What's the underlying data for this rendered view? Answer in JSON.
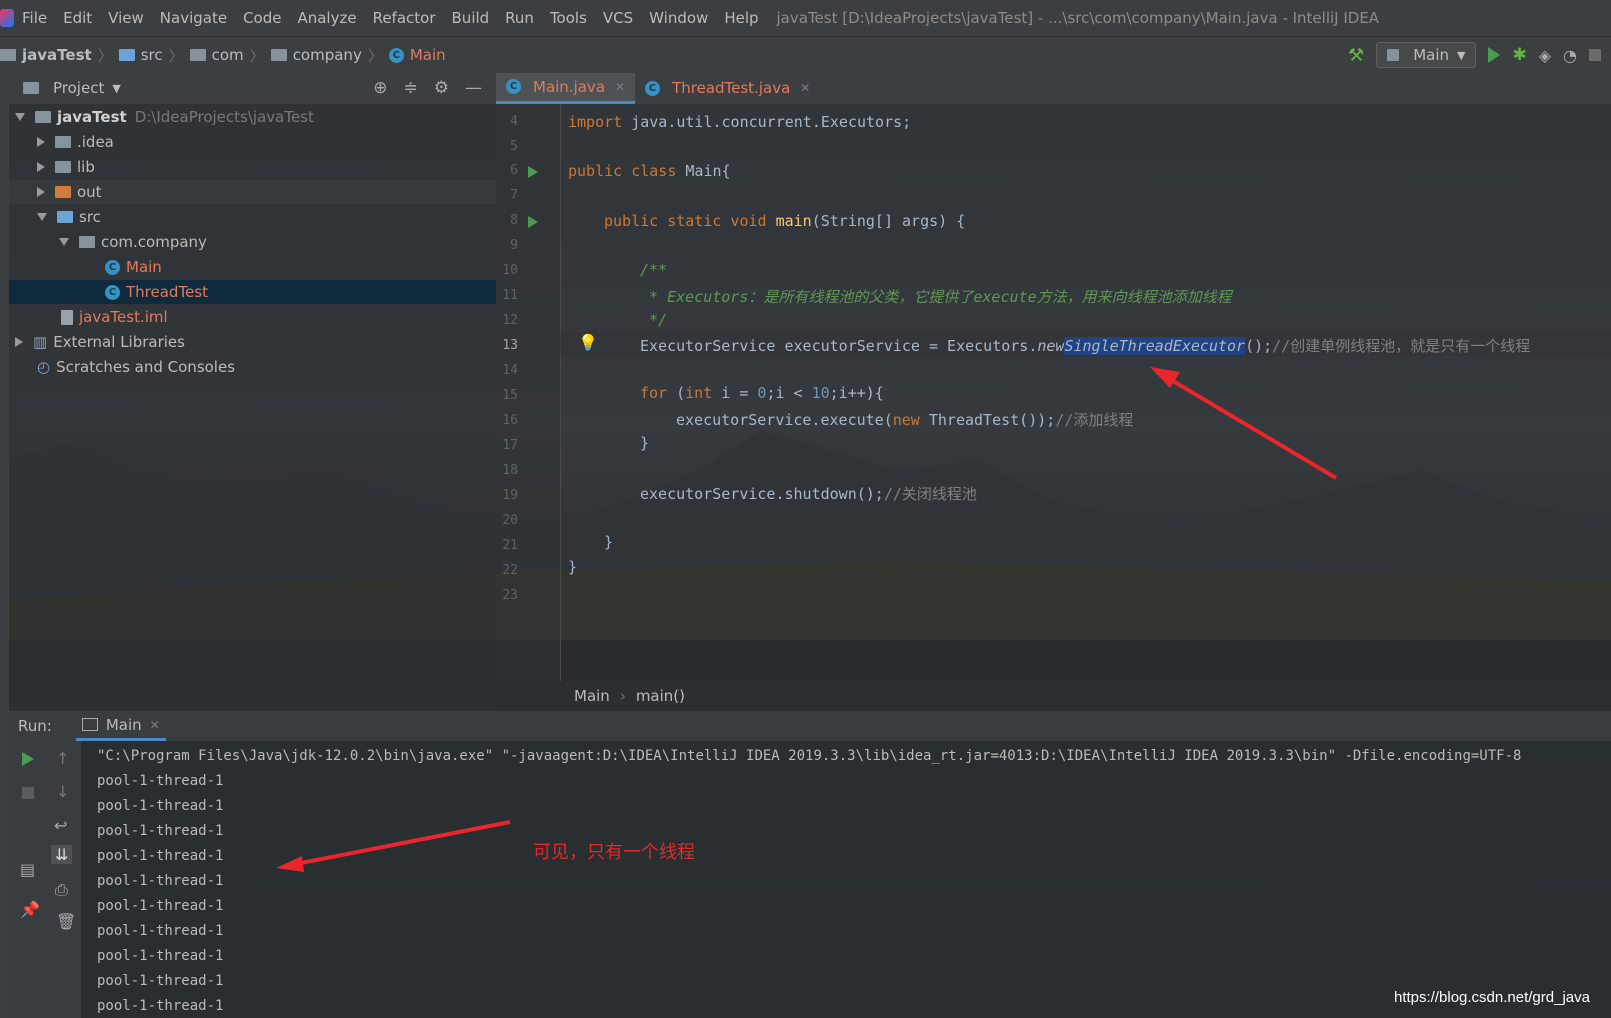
{
  "menubar": {
    "items": [
      "File",
      "Edit",
      "View",
      "Navigate",
      "Code",
      "Analyze",
      "Refactor",
      "Build",
      "Run",
      "Tools",
      "VCS",
      "Window",
      "Help"
    ],
    "title": "javaTest [D:\\IdeaProjects\\javaTest] - ...\\src\\com\\company\\Main.java - IntelliJ IDEA"
  },
  "navbar": {
    "crumbs": [
      "javaTest",
      "src",
      "com",
      "company",
      "Main"
    ],
    "run_config": "Main"
  },
  "project": {
    "header": "Project",
    "root": {
      "name": "javaTest",
      "path": "D:\\IdeaProjects\\javaTest"
    },
    "nodes": [
      ".idea",
      "lib",
      "out",
      "src",
      "com.company",
      "Main",
      "ThreadTest",
      "javaTest.iml",
      "External Libraries",
      "Scratches and Consoles"
    ]
  },
  "editor": {
    "tabs": [
      "Main.java",
      "ThreadTest.java"
    ],
    "line_numbers": [
      "4",
      "5",
      "6",
      "7",
      "8",
      "9",
      "10",
      "11",
      "12",
      "13",
      "14",
      "15",
      "16",
      "17",
      "18",
      "19",
      "20",
      "21",
      "22",
      "23"
    ],
    "code": {
      "l4": [
        "import",
        " java.util.concurrent.Executors;"
      ],
      "l6": [
        "public class",
        " Main{"
      ],
      "l8": [
        "public static void ",
        "main",
        "(String[] args) {"
      ],
      "l10": "/**",
      "l11": " * Executors：是所有线程池的父类，它提供了execute方法，用来向线程池添加线程",
      "l12": " */",
      "l13": [
        "ExecutorService executorService = Executors.",
        "new",
        "SingleThreadExecutor",
        "();",
        "//创建单例线程池，就是只有一个线程"
      ],
      "l15": [
        "for",
        " (",
        "int",
        " i = ",
        "0",
        ";i < ",
        "10",
        ";i++){"
      ],
      "l16": [
        "executorService.execute(",
        "new",
        " ThreadTest());",
        "//添加线程"
      ],
      "l17": "}",
      "l19": [
        "executorService.shutdown();",
        "//关闭线程池"
      ],
      "l21": "}",
      "l22": "}"
    },
    "crumbs": [
      "Main",
      "main()"
    ]
  },
  "run": {
    "label": "Run:",
    "tab": "Main",
    "command": "\"C:\\Program Files\\Java\\jdk-12.0.2\\bin\\java.exe\" \"-javaagent:D:\\IDEA\\IntelliJ IDEA 2019.3.3\\lib\\idea_rt.jar=4013:D:\\IDEA\\IntelliJ IDEA 2019.3.3\\bin\" -Dfile.encoding=UTF-8",
    "output": [
      "pool-1-thread-1",
      "pool-1-thread-1",
      "pool-1-thread-1",
      "pool-1-thread-1",
      "pool-1-thread-1",
      "pool-1-thread-1",
      "pool-1-thread-1",
      "pool-1-thread-1",
      "pool-1-thread-1",
      "pool-1-thread-1"
    ]
  },
  "annotation": "可见，只有一个线程",
  "watermark": "https://blog.csdn.net/grd_java",
  "colors": {
    "annotation_red": "#e02b2b",
    "keyword": "#cc7832",
    "comment_green": "#629755",
    "selection": "#214283"
  }
}
